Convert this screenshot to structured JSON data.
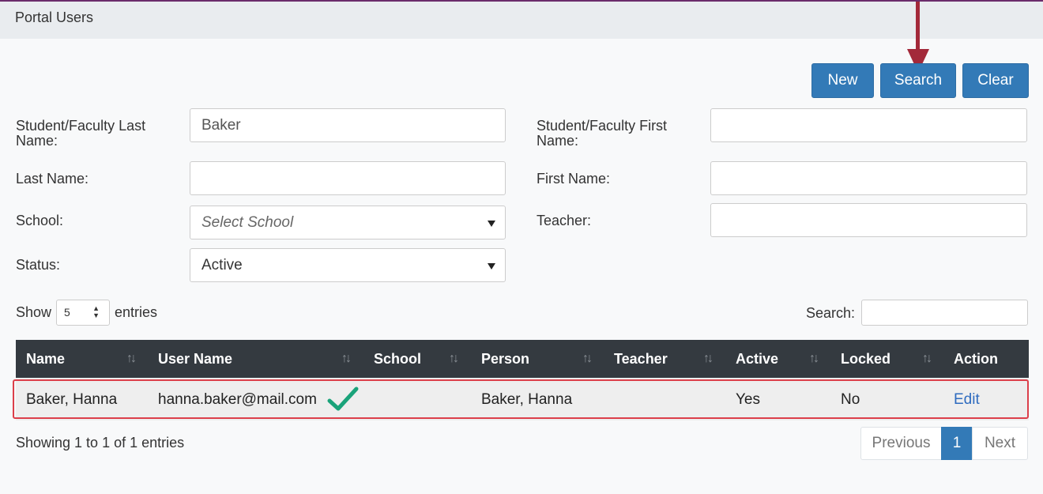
{
  "panel": {
    "title": "Portal Users"
  },
  "toolbar": {
    "new_label": "New",
    "search_label": "Search",
    "clear_label": "Clear"
  },
  "form": {
    "sf_last_name_label": "Student/Faculty Last Name:",
    "sf_last_name_value": "Baker",
    "sf_first_name_label": "Student/Faculty First Name:",
    "sf_first_name_value": "",
    "last_name_label": "Last Name:",
    "last_name_value": "",
    "first_name_label": "First Name:",
    "first_name_value": "",
    "school_label": "School:",
    "school_placeholder": "Select School",
    "teacher_label": "Teacher:",
    "teacher_value": "",
    "status_label": "Status:",
    "status_value": "Active"
  },
  "table_controls": {
    "show_label": "Show",
    "entries_count": "5",
    "entries_label": "entries",
    "search_label": "Search:"
  },
  "table": {
    "columns": [
      "Name",
      "User Name",
      "School",
      "Person",
      "Teacher",
      "Active",
      "Locked",
      "Action"
    ],
    "rows": [
      {
        "name": "Baker, Hanna",
        "user_name": "hanna.baker@mail.com",
        "school": "",
        "person": "Baker, Hanna",
        "teacher": "",
        "active": "Yes",
        "locked": "No",
        "action": "Edit"
      }
    ]
  },
  "footer": {
    "info": "Showing 1 to 1 of 1 entries",
    "previous": "Previous",
    "page": "1",
    "next": "Next"
  },
  "colors": {
    "primary": "#337ab7",
    "header_dark": "#343a40",
    "annotation_red": "#dc3f4a",
    "arrow": "#a3293a",
    "check": "#1aa37a"
  },
  "icons": {
    "sort": "sort-icon",
    "dropdown": "caret-down-icon",
    "check": "checkmark-icon",
    "arrow": "arrow-down-icon"
  }
}
